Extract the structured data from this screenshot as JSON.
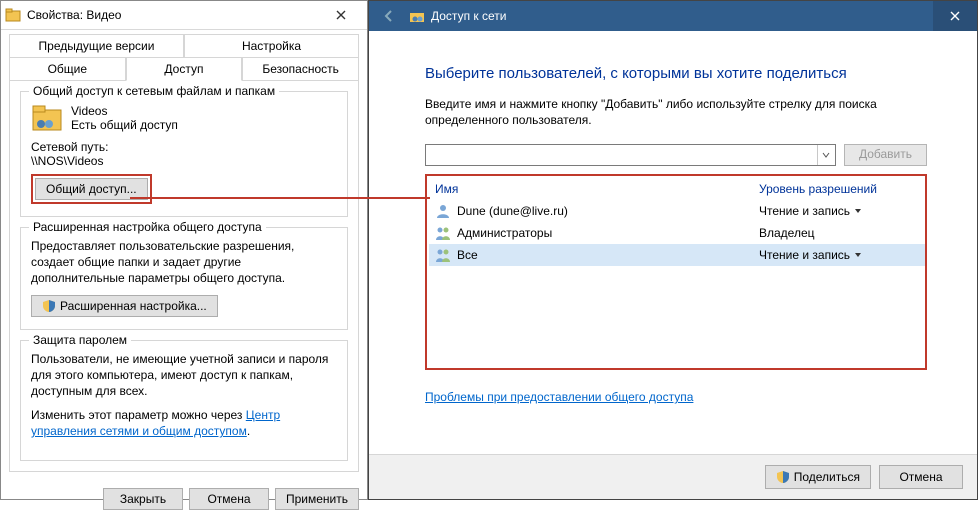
{
  "props": {
    "title": "Свойства: Видео",
    "tabs": {
      "prev": "Предыдущие версии",
      "setup": "Настройка",
      "general": "Общие",
      "access": "Доступ",
      "security": "Безопасность"
    },
    "share_group": {
      "title": "Общий доступ к сетевым файлам и папкам",
      "folder_name": "Videos",
      "folder_status": "Есть общий доступ",
      "netpath_label": "Сетевой путь:",
      "netpath": "\\\\NOS\\Videos",
      "share_btn": "Общий доступ..."
    },
    "adv_group": {
      "title": "Расширенная настройка общего доступа",
      "desc": "Предоставляет пользовательские разрешения, создает общие папки и задает другие дополнительные параметры общего доступа.",
      "btn": "Расширенная настройка..."
    },
    "pwd_group": {
      "title": "Защита паролем",
      "desc": "Пользователи, не имеющие учетной записи и пароля для этого компьютера, имеют доступ к папкам, доступным для всех.",
      "change_pre": "Изменить этот параметр можно через ",
      "change_link": "Центр управления сетями и общим доступом",
      "period": "."
    },
    "footer": {
      "close": "Закрыть",
      "cancel": "Отмена",
      "apply": "Применить"
    }
  },
  "wiz": {
    "title": "Доступ к сети",
    "heading": "Выберите пользователей, с которыми вы хотите поделиться",
    "instruction": "Введите имя и нажмите кнопку \"Добавить\" либо используйте стрелку для поиска определенного пользователя.",
    "add_btn": "Добавить",
    "cols": {
      "name": "Имя",
      "level": "Уровень разрешений"
    },
    "rows": [
      {
        "name": "Dune  (dune@live.ru)",
        "level": "Чтение и запись",
        "chev": true,
        "sel": false,
        "icon": "user"
      },
      {
        "name": "Администраторы",
        "level": "Владелец",
        "chev": false,
        "sel": false,
        "icon": "group"
      },
      {
        "name": "Все",
        "level": "Чтение и запись",
        "chev": true,
        "sel": true,
        "icon": "group"
      }
    ],
    "trouble": "Проблемы при предоставлении общего доступа",
    "footer": {
      "share": "Поделиться",
      "cancel": "Отмена"
    }
  }
}
